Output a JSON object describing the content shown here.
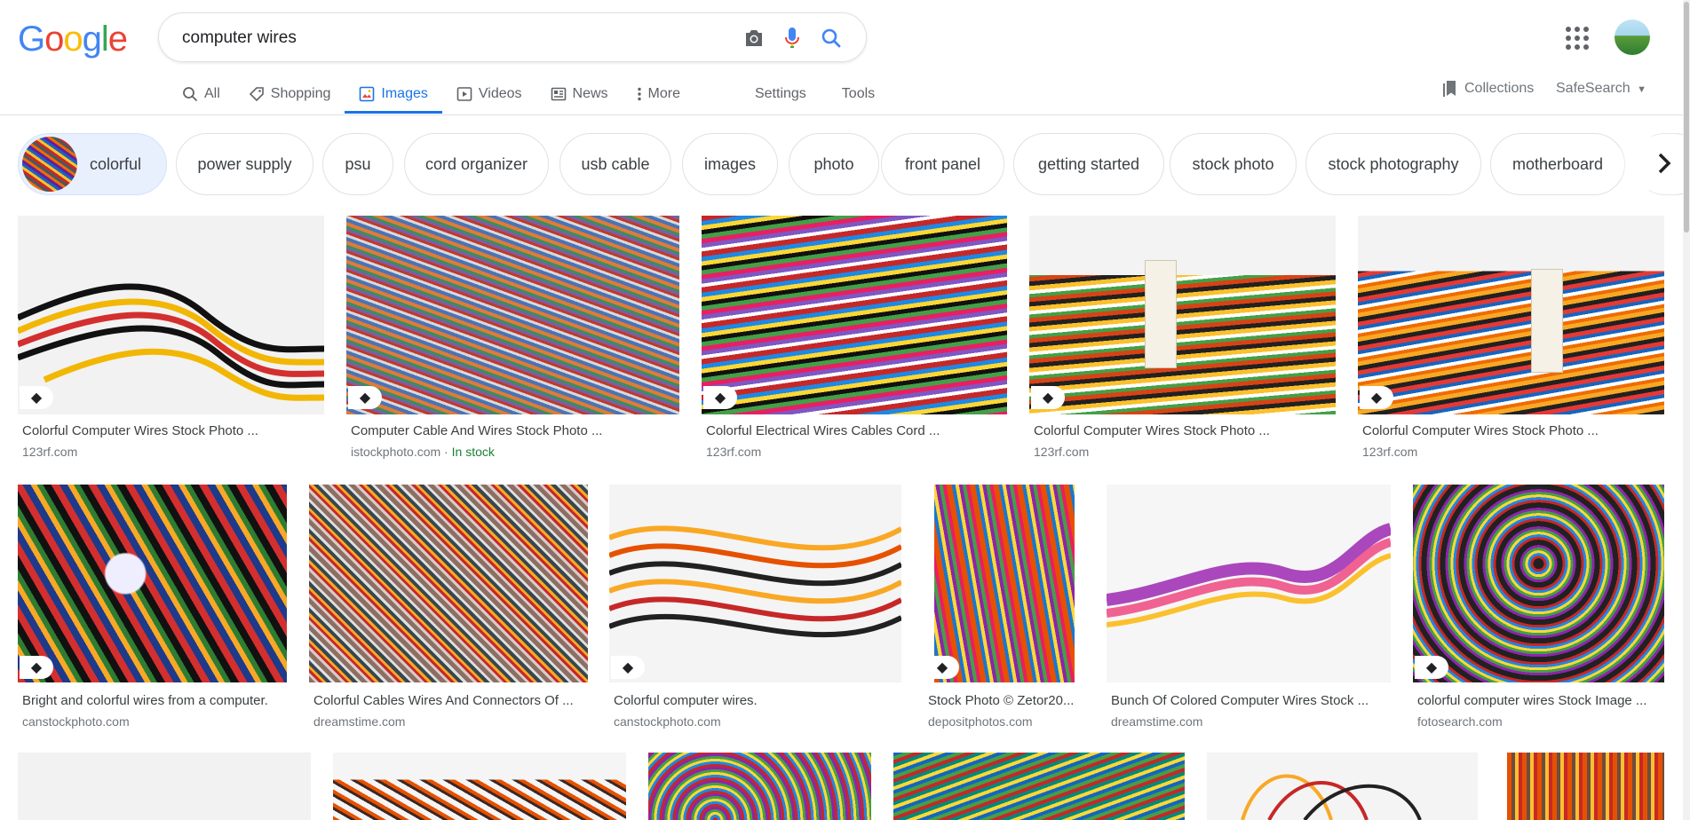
{
  "logo": {
    "letters": [
      "G",
      "o",
      "o",
      "g",
      "l",
      "e"
    ],
    "colors": [
      "#4285f4",
      "#ea4335",
      "#fbbc05",
      "#4285f4",
      "#34a853",
      "#ea4335"
    ]
  },
  "search": {
    "query": "computer wires"
  },
  "tabs": [
    {
      "label": "All",
      "icon": "search-icon"
    },
    {
      "label": "Shopping",
      "icon": "tag-icon"
    },
    {
      "label": "Images",
      "icon": "image-icon",
      "active": true
    },
    {
      "label": "Videos",
      "icon": "play-icon"
    },
    {
      "label": "News",
      "icon": "newspaper-icon"
    },
    {
      "label": "More",
      "icon": "more-vert-icon"
    }
  ],
  "tools": {
    "settings": "Settings",
    "tools": "Tools"
  },
  "header_right": {
    "collections": "Collections",
    "safesearch": "SafeSearch"
  },
  "chips": [
    "colorful",
    "power supply",
    "psu",
    "cord organizer",
    "usb cable",
    "images",
    "photo",
    "front panel",
    "getting started",
    "stock photo",
    "stock photography",
    "motherboard"
  ],
  "results_row1": [
    {
      "title": "Colorful Computer Wires Stock Photo ...",
      "source": "123rf.com"
    },
    {
      "title": "Computer Cable And Wires Stock Photo ...",
      "source": "istockphoto.com",
      "badge": "In stock"
    },
    {
      "title": "Colorful Electrical Wires Cables Cord ...",
      "source": "123rf.com"
    },
    {
      "title": "Colorful Computer Wires Stock Photo ...",
      "source": "123rf.com"
    },
    {
      "title": "Colorful Computer Wires Stock Photo ...",
      "source": "123rf.com"
    }
  ],
  "results_row2": [
    {
      "title": "Bright and colorful wires from a computer.",
      "source": "canstockphoto.com"
    },
    {
      "title": "Colorful Cables Wires And Connectors Of ...",
      "source": "dreamstime.com"
    },
    {
      "title": "Colorful computer wires.",
      "source": "canstockphoto.com"
    },
    {
      "title": "Stock Photo © Zetor20...",
      "source": "depositphotos.com"
    },
    {
      "title": "Bunch Of Colored Computer Wires Stock ...",
      "source": "dreamstime.com"
    },
    {
      "title": "colorful computer wires Stock Image ...",
      "source": "fotosearch.com"
    }
  ],
  "colors": {
    "accent": "#1a73e8",
    "in_stock": "#188038"
  }
}
